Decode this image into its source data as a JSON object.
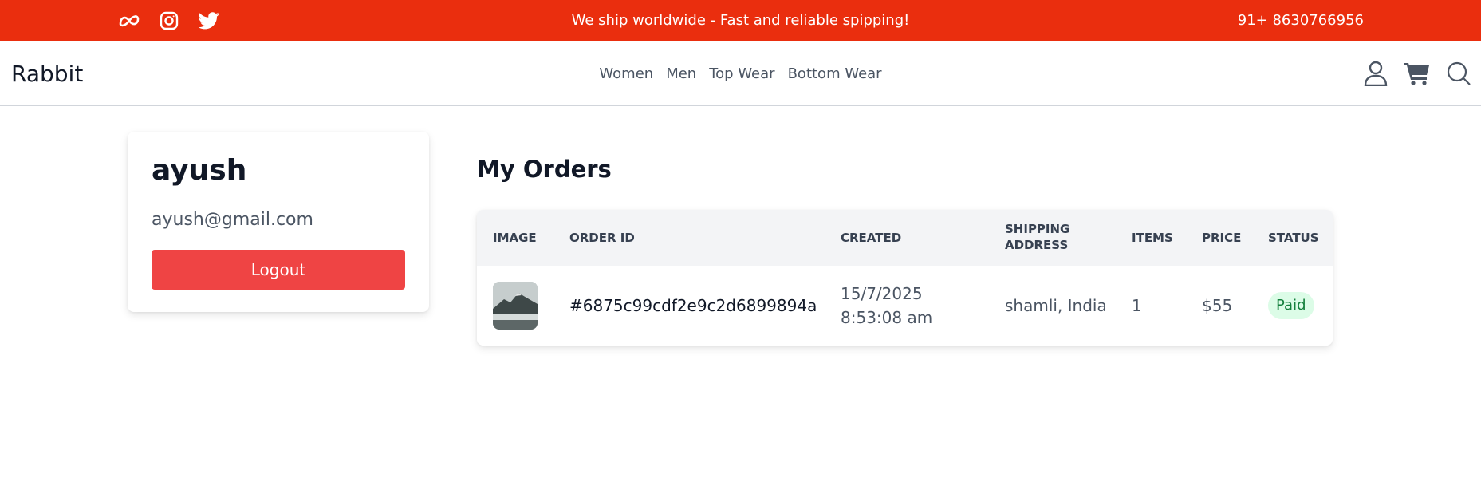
{
  "topbar": {
    "announcement": "We ship worldwide - Fast and reliable spipping!",
    "phone": "91+ 8630766956",
    "social_icons": [
      "meta-icon",
      "instagram-icon",
      "twitter-icon"
    ]
  },
  "navbar": {
    "brand": "Rabbit",
    "links": [
      "Women",
      "Men",
      "Top Wear",
      "Bottom Wear"
    ],
    "icons": [
      "user-icon",
      "cart-icon",
      "search-icon"
    ]
  },
  "profile": {
    "name": "ayush",
    "email": "ayush@gmail.com",
    "logout_label": "Logout"
  },
  "orders": {
    "title": "My Orders",
    "columns": [
      "Image",
      "Order ID",
      "Created",
      "Shipping Address",
      "Items",
      "Price",
      "Status"
    ],
    "rows": [
      {
        "order_id": "#6875c99cdf2e9c2d6899894a",
        "created_date": "15/7/2025",
        "created_time": "8:53:08 am",
        "shipping_address": "shamli, India",
        "items": "1",
        "price": "$55",
        "status": "Paid"
      }
    ]
  },
  "colors": {
    "topbar": "#ea2e0e",
    "logout": "#ef4444",
    "paid_badge_bg": "#dcfce7",
    "paid_badge_text": "#15803d"
  }
}
